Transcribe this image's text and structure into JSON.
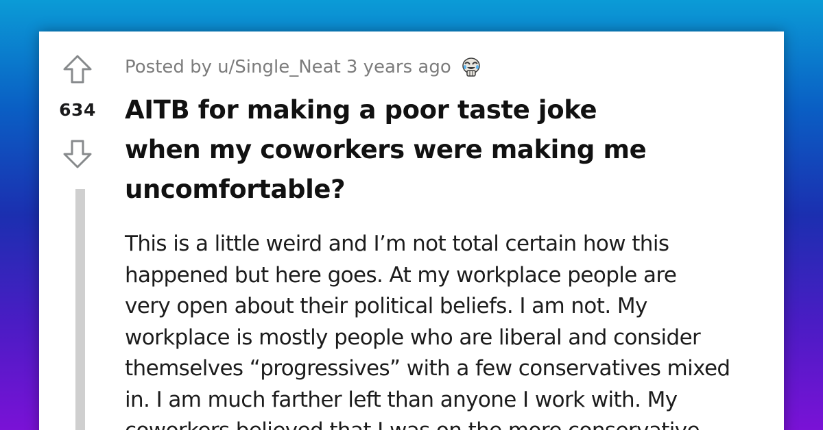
{
  "post": {
    "votes": "634",
    "posted_by_prefix": "Posted by",
    "username": "u/Single_Neat",
    "time_ago": "3 years ago",
    "award_icon": "skull-laughing-award-icon",
    "title_lines": [
      "AITB for making a poor taste joke",
      "when my coworkers were making me",
      "uncomfortable?"
    ],
    "body_lines": [
      "This is a little weird and I’m not total certain how this",
      "happened but here goes. At my workplace people are",
      "very open about their political beliefs. I am not. My",
      "workplace is mostly people who are liberal and consider",
      "themselves “progressives” with a few conservatives mixed",
      "in. I am much farther left than anyone I work with. My",
      "coworkers believed that I was on the more conservative"
    ]
  },
  "colors": {
    "card_background": "#ffffff",
    "text_primary": "#111111",
    "text_meta": "#7c7c7c",
    "vote_arrow": "#878a8c",
    "thread_line": "#cfcfcf"
  }
}
